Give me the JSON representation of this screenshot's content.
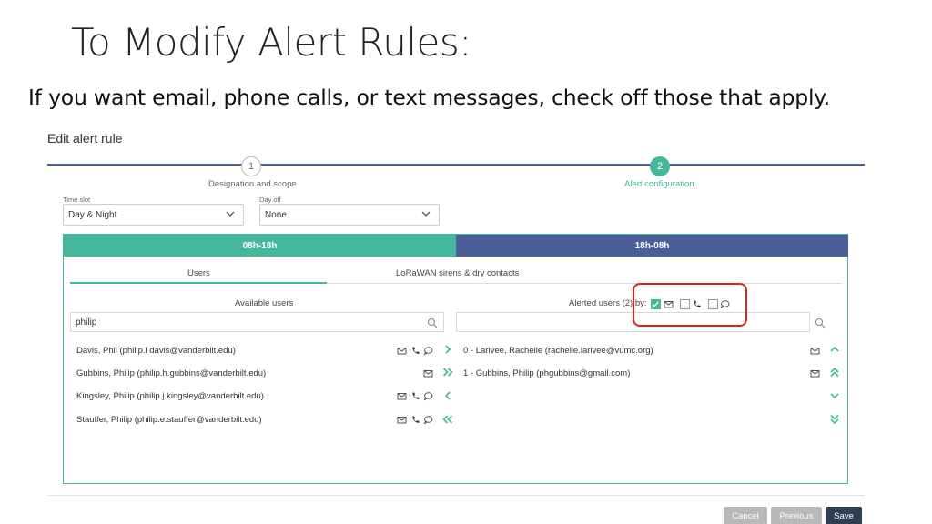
{
  "slide": {
    "title": "To Modify Alert Rules:",
    "subtitle": "If you want email, phone calls, or text messages, check off those that apply."
  },
  "page": {
    "heading": "Edit alert rule"
  },
  "stepper": {
    "steps": [
      {
        "number": "1",
        "label": "Designation and scope"
      },
      {
        "number": "2",
        "label": "Alert configuration"
      }
    ]
  },
  "filters": {
    "time_slot": {
      "label": "Time slot",
      "value": "Day & Night"
    },
    "day_off": {
      "label": "Day off",
      "value": "None"
    }
  },
  "time_tabs": [
    "08h-18h",
    "18h-08h"
  ],
  "subtabs": [
    "Users",
    "LoRaWAN sirens & dry contacts"
  ],
  "available": {
    "header": "Available users",
    "search_value": "philip",
    "users": [
      {
        "name": "Davis, Phil (philip.l davis@vanderbilt.edu)"
      },
      {
        "name": "Gubbins, Philip (philip.h.gubbins@vanderbilt.edu)"
      },
      {
        "name": "Kingsley, Philip (philip.j.kingsley@vanderbilt.edu)"
      },
      {
        "name": "Stauffer, Philip (philip.e.stauffer@vanderbilt.edu)"
      }
    ]
  },
  "alerted": {
    "header": "Alerted users (2) by:",
    "search_value": "",
    "channels": {
      "email": true,
      "phone": false,
      "sms": false
    },
    "users": [
      {
        "name": "0 - Larivee, Rachelle (rachelle.larivee@vumc.org)"
      },
      {
        "name": "1 - Gubbins, Philip (phgubbins@gmail.com)"
      }
    ]
  },
  "buttons": {
    "cancel": "Cancel",
    "previous": "Previous",
    "save": "Save"
  },
  "colors": {
    "accent_green": "#45b79b",
    "accent_blue": "#4a5f9a",
    "highlight_red": "#e02020",
    "save_dark": "#2f3e55"
  }
}
